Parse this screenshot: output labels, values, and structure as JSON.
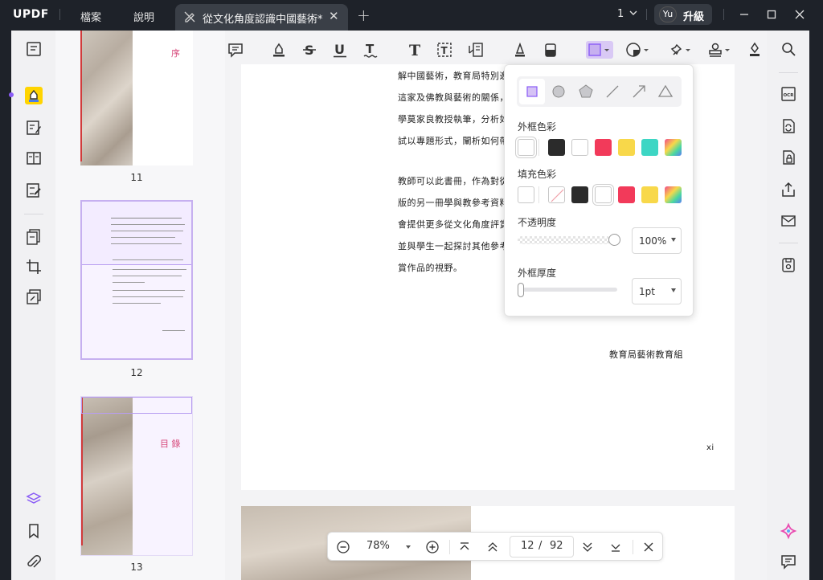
{
  "app": {
    "logo_text": "UPDF"
  },
  "menu": {
    "file": "檔案",
    "help": "說明"
  },
  "tab": {
    "title": "從文化角度認識中國藝術*",
    "close": "✕",
    "new_tab": "+"
  },
  "title_right": {
    "window_count": "1",
    "avatar": "Yu",
    "upgrade": "升級"
  },
  "thumbnails": [
    {
      "page": "11",
      "heading": "序"
    },
    {
      "page": "12"
    },
    {
      "page": "13",
      "heading": "目 錄"
    }
  ],
  "document": {
    "lines_block1": [
      "解中國藝術，教育局特別邀請岑逸",
      "這家及佛教與藝術的關係，介紹中",
      "學莫家良教授執筆，分析如何從文",
      "試以專題形式，闡析如何帶引學生"
    ],
    "lines_block2": [
      "教師可以此書冊，作為對從文化角",
      "版的另一冊學與教參考資料《藝術",
      "會提供更多從文化角度評賞中國藝",
      "並與學生一起探討其他參考材料，",
      "賞作品的視野。"
    ],
    "signature": "教育局藝術教育組",
    "page_number": "xi"
  },
  "shape_popup": {
    "border_color_label": "外框色彩",
    "fill_color_label": "填充色彩",
    "opacity_label": "不透明度",
    "opacity_value": "100%",
    "opacity_fraction": 1.0,
    "thickness_label": "外框厚度",
    "thickness_value": "1pt",
    "border_colors": [
      "#ffffff",
      "#2b2b2b",
      "#ffffff",
      "#f23a5a",
      "#f8d84a",
      "#3dd6c4",
      "gradient"
    ],
    "fill_colors": [
      "#ffffff",
      "none",
      "#2b2b2b",
      "#ffffff",
      "#f23a5a",
      "#f8d84a",
      "gradient"
    ]
  },
  "bottom_nav": {
    "zoom": "78%",
    "current_page": "12",
    "separator": "/",
    "total_pages": "92"
  },
  "colors": {
    "accent": "#8a5cf6",
    "shape_selected": "#d9c9f5",
    "highlight_yellow": "#ffd400"
  }
}
